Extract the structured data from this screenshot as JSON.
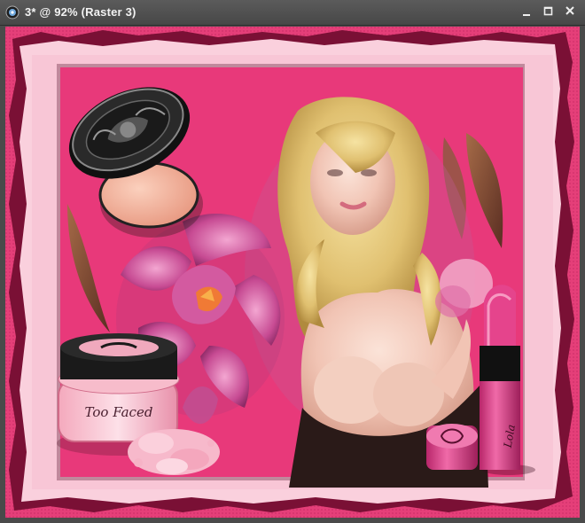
{
  "window": {
    "title": "3* @  92% (Raster 3)",
    "zoom_percent": 92,
    "layer_name": "Raster 3",
    "controls": [
      "minimize-icon",
      "maximize-icon",
      "close-icon"
    ]
  },
  "artwork": {
    "colors": {
      "frame_outer": "#e8407a",
      "frame_torn_edge": "#7a1035",
      "frame_light": "#f9c8d8",
      "panel_hot_pink": "#e83a7a",
      "lipstick": "#d63d83",
      "blush_pink": "#f6b6c6"
    },
    "jar_lettering": "Too Faced",
    "lipstick_lettering": "Lola",
    "icons": [
      "compact-powder",
      "orchid-flower",
      "blonde-woman",
      "lipstick",
      "powder-jar",
      "powder-crumbs"
    ]
  }
}
